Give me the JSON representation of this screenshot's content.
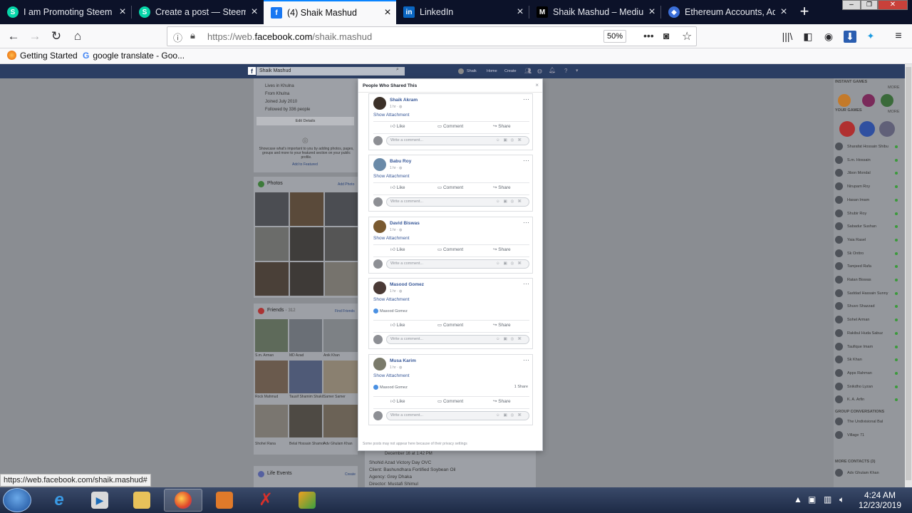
{
  "browser": {
    "tabs": [
      {
        "title": "I am Promoting Steem on",
        "icon": "steemit-icon",
        "color": "#06d6a9",
        "active": false
      },
      {
        "title": "Create a post — Steemit",
        "icon": "steemit-icon",
        "color": "#06d6a9",
        "active": false
      },
      {
        "title": "(4) Shaik Mashud",
        "icon": "facebook-icon",
        "color": "#1877f2",
        "active": true
      },
      {
        "title": "LinkedIn",
        "icon": "linkedin-icon",
        "color": "#0a66c2",
        "active": false
      },
      {
        "title": "Shaik Mashud – Medium",
        "icon": "medium-icon",
        "color": "#000000",
        "active": false
      },
      {
        "title": "Ethereum Accounts, Addr",
        "icon": "ethereum-icon",
        "color": "#3b6fd8",
        "active": false
      }
    ],
    "new_tab": "+",
    "url_prefix": "https://web.",
    "url_domain": "facebook.com",
    "url_path": "/shaik.mashud",
    "zoom": "50%",
    "bookmarks": [
      {
        "label": "Getting Started",
        "icon": "firefox-icon"
      },
      {
        "label": "google translate - Goo...",
        "icon": "google-icon"
      }
    ]
  },
  "facebook": {
    "search_value": "Shaik Mashud",
    "nav": [
      "Shaik",
      "Home",
      "Create"
    ],
    "intro": [
      "Lives in Khulna",
      "From Khulna",
      "Joined July 2010",
      "Followed by 336 people"
    ],
    "edit_details": "Edit Details",
    "featured_text": "Showcase what's important to you by adding photos, pages, groups and more to your featured section on your public profile.",
    "add_featured": "Add to Featured",
    "photos_title": "Photos",
    "add_photo": "Add Photo",
    "friends_title": "Friends",
    "friends_count": "312",
    "find_friends": "Find Friends",
    "friends": [
      "S.m. Arman",
      "MD Azad",
      "Anik Khan",
      "Rock Mahmud",
      "Tausif Shamim Shakil",
      "Samer Samer",
      "Shohel Rana",
      "Belal Hossain Shamol",
      "Adv Ghulam Khan"
    ],
    "life_events": "Life Events",
    "create": "Create",
    "below_post": [
      "December 16 at 1:42 PM",
      "Shohid Azad Victory Day OVC",
      "Client: Bashundhara Fortified Soybean Oil",
      "Agency: Grey Dhaka",
      "Director: Mustafi Shimul"
    ],
    "chat_sections": {
      "games": "INSTANT GAMES",
      "more": "MORE",
      "your_games": "YOUR GAMES",
      "groups": "GROUP CONVERSATIONS",
      "more_contacts": "MORE CONTACTS (3)"
    },
    "contacts": [
      "Sharafat Hossain Shibu",
      "S.m. Hossain",
      "Jibon Mondal",
      "Nirupam Roy",
      "Hasan Imam",
      "Shubir Roy",
      "Sabadur Sushan",
      "Yaia Rasel",
      "Sk Onttro",
      "Tamjeed Rafa",
      "Ratan Biswas",
      "Saddad Hassain Sunny",
      "Shuvo Shazzad",
      "Sohel Arman",
      "Rakibul Huda Sabuz",
      "Taufique Imam",
      "Sk Khan",
      "Apps Rahman",
      "Snikdho Lyzan",
      "K. A. Arfin"
    ],
    "group_convs": [
      "The Undivisional Bal",
      "Village 71",
      "Adv Ghulam Khan"
    ]
  },
  "modal": {
    "title": "People Who Shared This",
    "close": "×",
    "footer": "Some posts may not appear here because of their privacy settings",
    "posts": [
      {
        "name": "Shaik Akram",
        "time": "1 hr · ",
        "attachment": "Show Attachment",
        "reaction": "",
        "shares": ""
      },
      {
        "name": "Babu Roy",
        "time": "1 hr · ",
        "attachment": "Show Attachment",
        "reaction": "",
        "shares": ""
      },
      {
        "name": "David Biswas",
        "time": "1 hr · ",
        "attachment": "Show Attachment",
        "reaction": "",
        "shares": ""
      },
      {
        "name": "Masood Gomez",
        "time": "1 hr · ",
        "attachment": "Show Attachment",
        "reaction": "Masood Gomez",
        "shares": ""
      },
      {
        "name": "Musa Karim",
        "time": "1 hr · ",
        "attachment": "Show Attachment",
        "reaction": "Masood Gomez",
        "shares": "1 Share"
      }
    ],
    "like": "Like",
    "comment": "Comment",
    "share": "Share",
    "comment_placeholder": "Write a comment..."
  },
  "status_url": "https://web.facebook.com/shaik.mashud#",
  "taskbar": {
    "time": "4:24 AM",
    "date": "12/23/2019"
  }
}
